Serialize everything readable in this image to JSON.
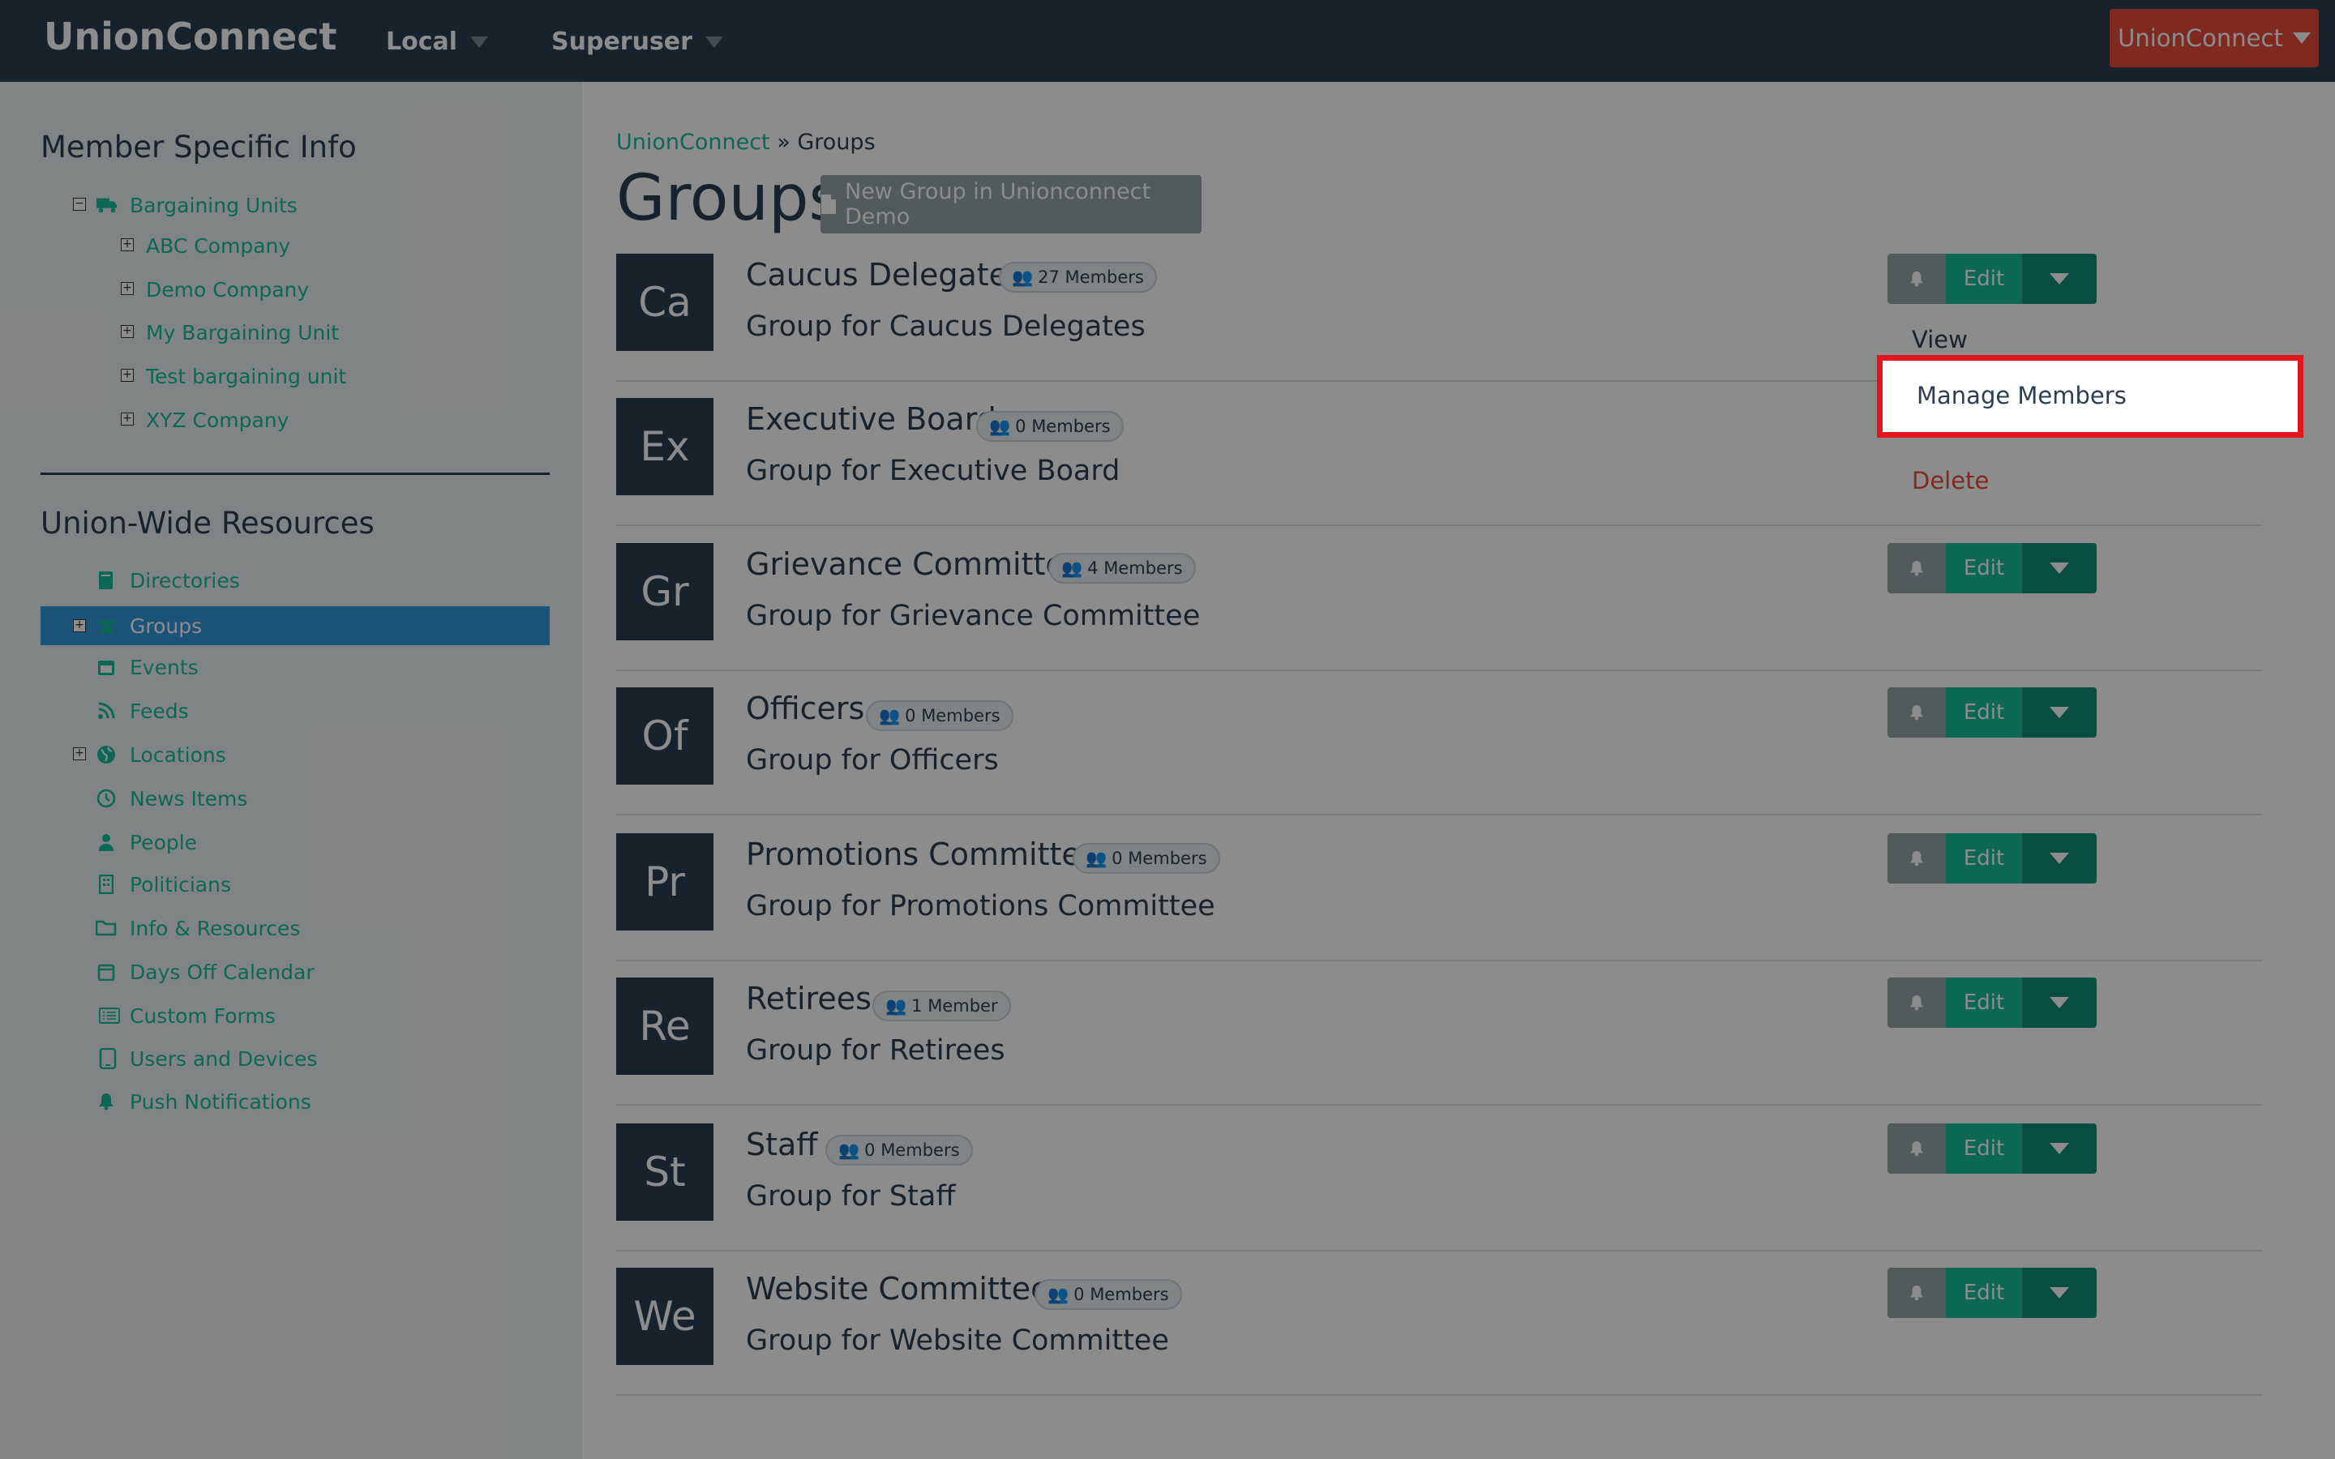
{
  "navbar": {
    "brand": "UnionConnect",
    "local_label": "Local",
    "user_label": "Superuser",
    "brand_button_label": "UnionConnect"
  },
  "sidebar": {
    "member_heading": "Member Specific Info",
    "bargaining_root": "Bargaining Units",
    "bargaining_units": [
      "ABC Company",
      "Demo Company",
      "My Bargaining Unit",
      "Test bargaining unit",
      "XYZ Company"
    ],
    "resources_heading": "Union-Wide Resources",
    "resources": [
      {
        "label": "Directories",
        "icon": "book-icon"
      },
      {
        "label": "Groups",
        "icon": "users-icon",
        "active": true
      },
      {
        "label": "Events",
        "icon": "calendar-icon"
      },
      {
        "label": "Feeds",
        "icon": "rss-icon"
      },
      {
        "label": "Locations",
        "icon": "globe-icon"
      },
      {
        "label": "News Items",
        "icon": "clock-icon"
      },
      {
        "label": "People",
        "icon": "person-icon"
      },
      {
        "label": "Politicians",
        "icon": "building-icon"
      },
      {
        "label": "Info & Resources",
        "icon": "folder-icon"
      },
      {
        "label": "Days Off Calendar",
        "icon": "calendar-icon"
      },
      {
        "label": "Custom Forms",
        "icon": "list-icon"
      },
      {
        "label": "Users and Devices",
        "icon": "tablet-icon"
      },
      {
        "label": "Push Notifications",
        "icon": "bell-icon"
      }
    ]
  },
  "main": {
    "breadcrumb_root": "UnionConnect",
    "breadcrumb_sep": "»",
    "breadcrumb_current": "Groups",
    "title": "Groups",
    "new_group_label": "New Group in Unionconnect Demo",
    "edit_label": "Edit",
    "groups": [
      {
        "abbr": "Ca",
        "name": "Caucus Delegates",
        "members": "27 Members",
        "desc": "Group for Caucus Delegates"
      },
      {
        "abbr": "Ex",
        "name": "Executive Board",
        "members": "0 Members",
        "desc": "Group for Executive Board"
      },
      {
        "abbr": "Gr",
        "name": "Grievance Committee",
        "members": "4 Members",
        "desc": "Group for Grievance Committee"
      },
      {
        "abbr": "Of",
        "name": "Officers",
        "members": "0 Members",
        "desc": "Group for Officers"
      },
      {
        "abbr": "Pr",
        "name": "Promotions Committee",
        "members": "0 Members",
        "desc": "Group for Promotions Committee"
      },
      {
        "abbr": "Re",
        "name": "Retirees",
        "members": "1 Member",
        "desc": "Group for Retirees"
      },
      {
        "abbr": "St",
        "name": "Staff",
        "members": "0 Members",
        "desc": "Group for Staff"
      },
      {
        "abbr": "We",
        "name": "Website Committee",
        "members": "0 Members",
        "desc": "Group for Website Committee"
      }
    ]
  },
  "dropdown_menu": {
    "view": "View",
    "manage_members": "Manage Members",
    "delete": "Delete"
  },
  "colors": {
    "navbar": "#2c3e50",
    "accent": "#18bc9c",
    "danger": "#e74c3c",
    "active": "#3498db",
    "highlight": "#e3141b"
  }
}
